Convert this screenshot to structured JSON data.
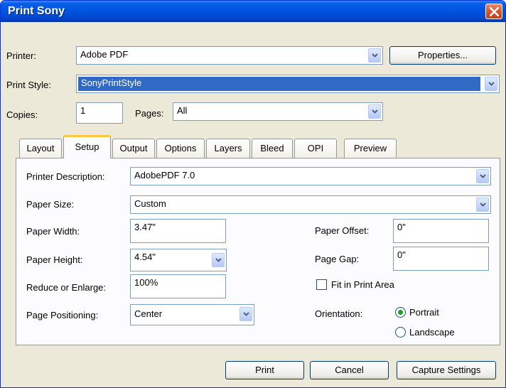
{
  "window": {
    "title": "Print Sony"
  },
  "printer": {
    "label": "Printer:",
    "value": "Adobe PDF",
    "properties_button": "Properties..."
  },
  "print_style": {
    "label": "Print Style:",
    "value": "SonyPrintStyle"
  },
  "copies": {
    "label": "Copies:",
    "value": "1"
  },
  "pages": {
    "label": "Pages:",
    "value": "All"
  },
  "tabs": [
    {
      "label": "Layout"
    },
    {
      "label": "Setup",
      "active": true
    },
    {
      "label": "Output"
    },
    {
      "label": "Options"
    },
    {
      "label": "Layers"
    },
    {
      "label": "Bleed"
    },
    {
      "label": "OPI"
    },
    {
      "label": "Preview"
    }
  ],
  "setup": {
    "printer_description": {
      "label": "Printer Description:",
      "value": "AdobePDF 7.0"
    },
    "paper_size": {
      "label": "Paper Size:",
      "value": "Custom"
    },
    "paper_width": {
      "label": "Paper Width:",
      "value": "3.47\""
    },
    "paper_height": {
      "label": "Paper Height:",
      "value": "4.54\""
    },
    "reduce_enlarge": {
      "label": "Reduce or Enlarge:",
      "value": "100%"
    },
    "page_positioning": {
      "label": "Page Positioning:",
      "value": "Center"
    },
    "paper_offset": {
      "label": "Paper Offset:",
      "value": "0\""
    },
    "page_gap": {
      "label": "Page Gap:",
      "value": "0\""
    },
    "fit_in_print_area": {
      "label": "Fit in Print Area",
      "checked": false
    },
    "orientation": {
      "label": "Orientation:",
      "options": [
        {
          "label": "Portrait",
          "selected": true
        },
        {
          "label": "Landscape",
          "selected": false
        }
      ]
    }
  },
  "buttons": {
    "print": "Print",
    "cancel": "Cancel",
    "capture_settings": "Capture Settings"
  },
  "colors": {
    "title_bar": "#0054E3",
    "dialog_bg": "#ECE9D8",
    "selection": "#316AC5",
    "active_tab_accent": "#FFC83C"
  }
}
